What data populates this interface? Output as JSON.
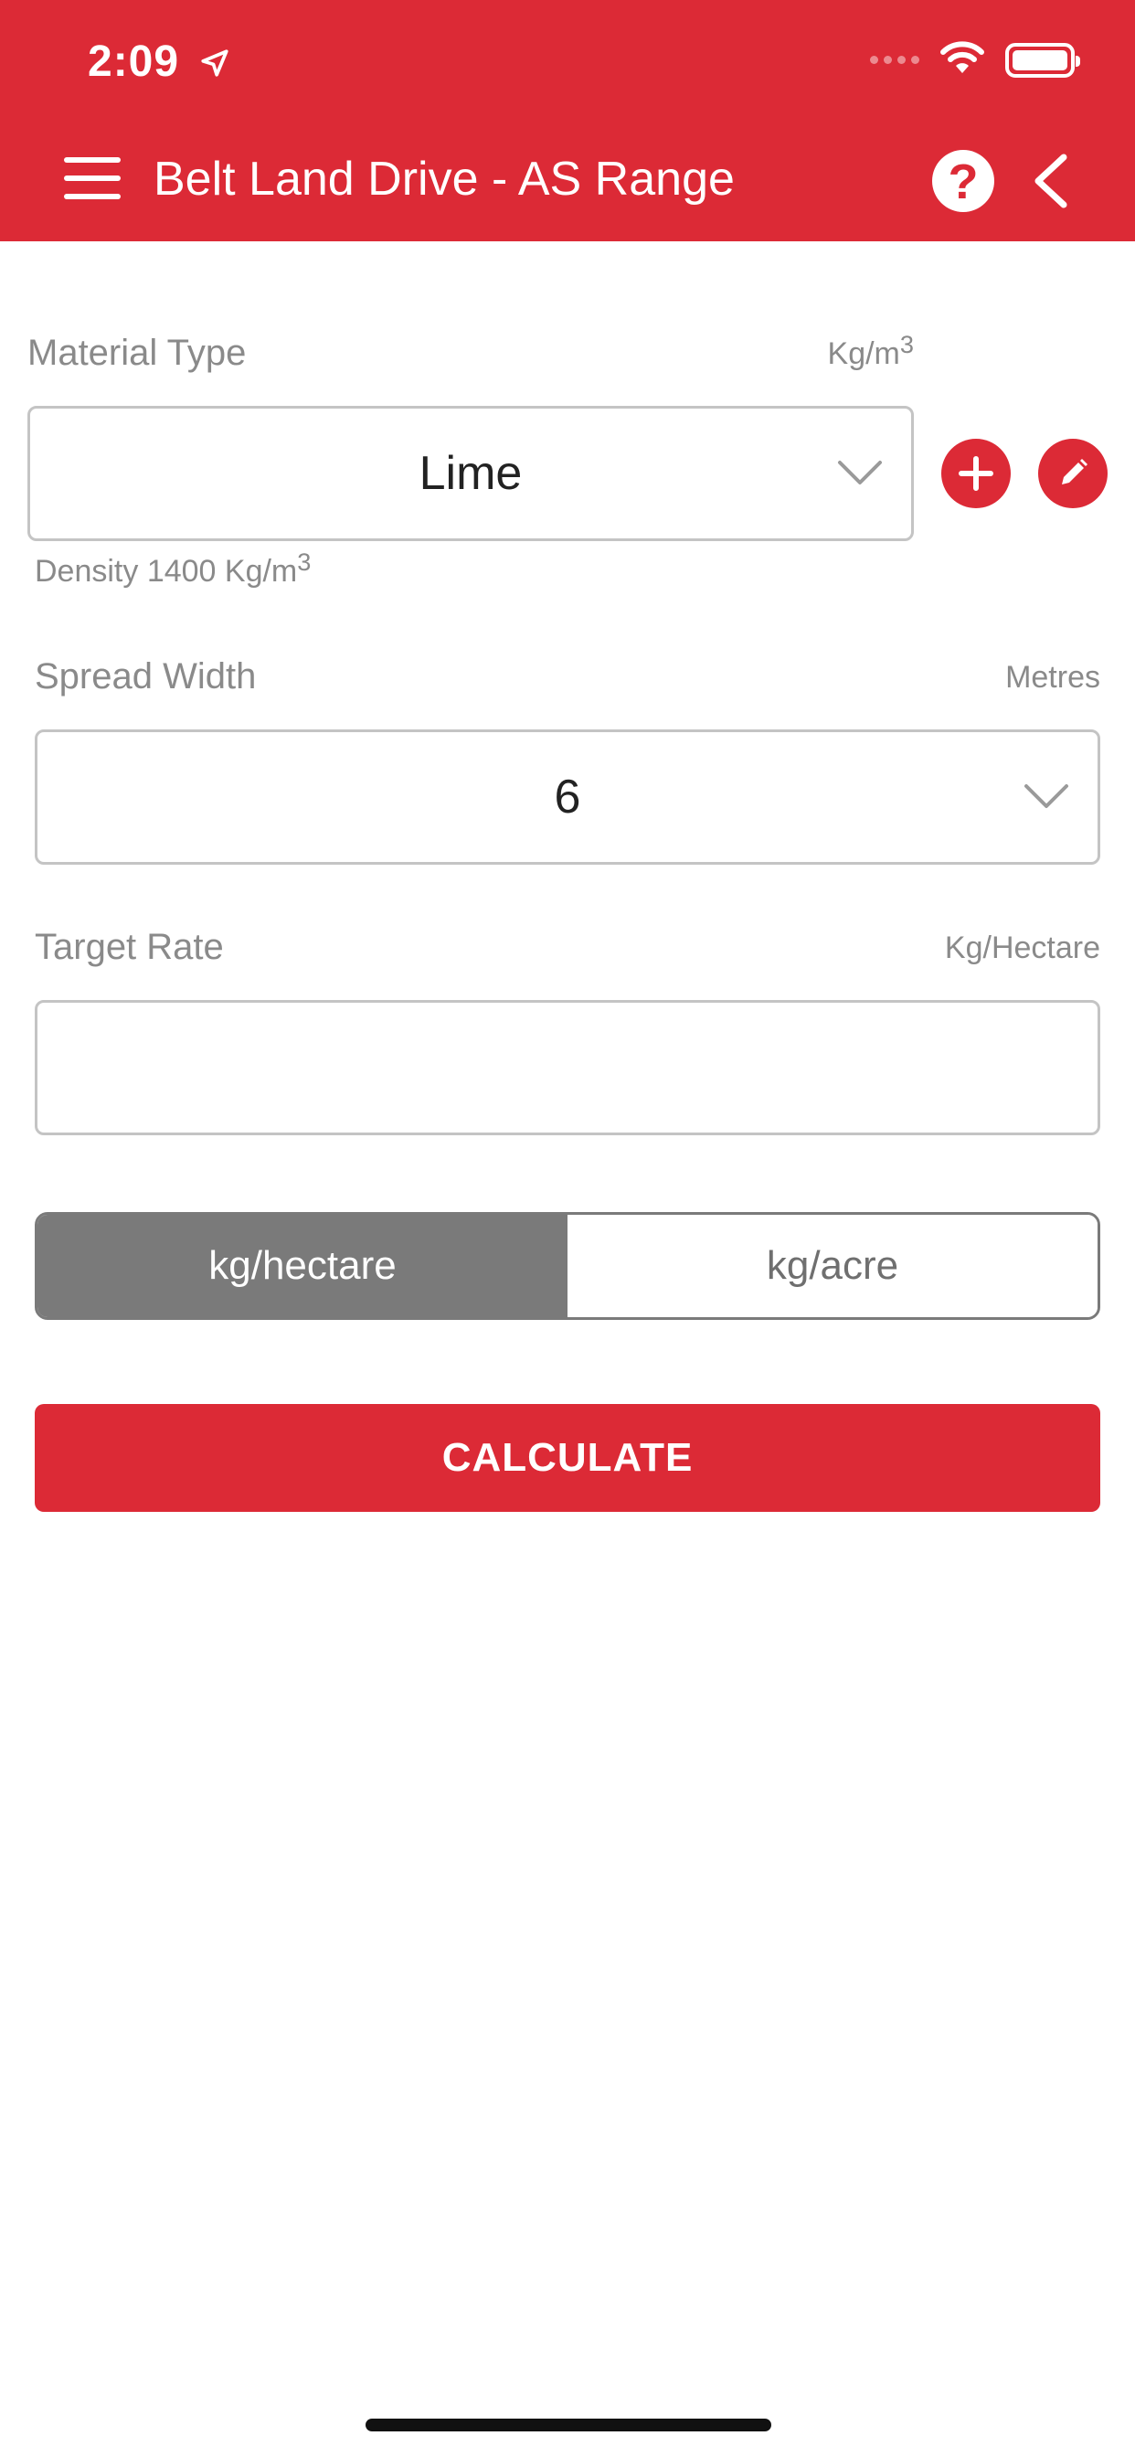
{
  "status_bar": {
    "time": "2:09"
  },
  "header": {
    "title": "Belt Land Drive - AS Range",
    "help_glyph": "?"
  },
  "material": {
    "label": "Material Type",
    "unit_base": "Kg/m",
    "unit_exp": "3",
    "selected": "Lime",
    "density_prefix": "Density 1400 Kg/m",
    "density_exp": "3"
  },
  "spread": {
    "label": "Spread Width",
    "unit": "Metres",
    "selected": "6"
  },
  "target": {
    "label": "Target Rate",
    "unit": "Kg/Hectare",
    "value": "",
    "placeholder": ""
  },
  "rate_toggle": {
    "options": [
      "kg/hectare",
      "kg/acre"
    ],
    "active_index": 0
  },
  "calculate_label": "CALCULATE",
  "colors": {
    "brand_red": "#dc2a36",
    "toggle_active": "#7a7a7a",
    "border_gray": "#c4c4c4",
    "label_gray": "#8a8a8a"
  },
  "icons": [
    "menu-icon",
    "location-arrow-icon",
    "wifi-icon",
    "battery-icon",
    "help-icon",
    "back-chevron-icon",
    "add-icon",
    "edit-pencil-icon",
    "chevron-down-icon"
  ]
}
